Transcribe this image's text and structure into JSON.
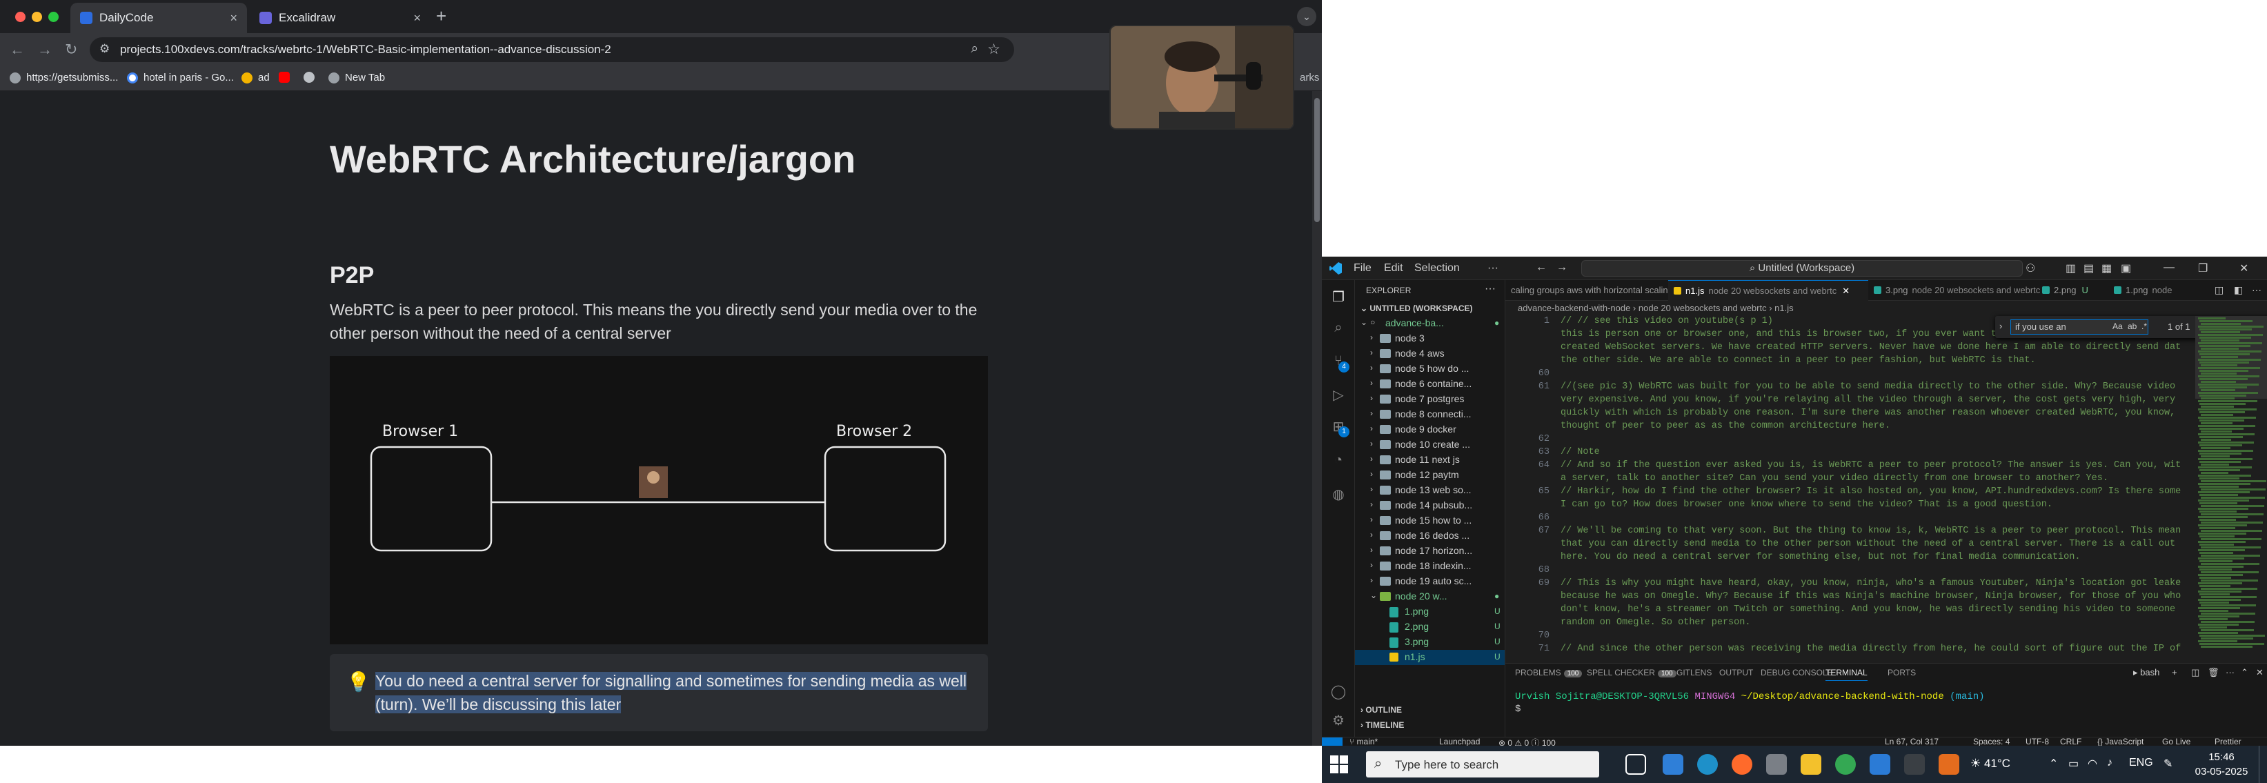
{
  "browser": {
    "tabs": [
      {
        "label": "DailyCode",
        "active": true
      },
      {
        "label": "Excalidraw",
        "active": false
      }
    ],
    "url": "projects.100xdevs.com/tracks/webrtc-1/WebRTC-Basic-implementation--advance-discussion-2",
    "bookmarks": [
      "https://getsubmiss...",
      "hotel in paris - Go...",
      "ad",
      "New Tab"
    ],
    "bookmarks_more": "arks"
  },
  "page": {
    "title": "WebRTC Architecture/jargon",
    "section_heading": "P2P",
    "paragraph": "WebRTC is a peer to peer protocol. This means the you directly send your media over to the other person without the need of a central server",
    "diagram": {
      "left_label": "Browser 1",
      "right_label": "Browser 2"
    },
    "callout": {
      "text_highlighted": "You do need a central server for signalling and sometimes for sending media as well (turn). We’ll be discussing this later"
    }
  },
  "vscode": {
    "menu": [
      "File",
      "Edit",
      "Selection",
      "···"
    ],
    "search": "Untitled (Workspace)",
    "explorer_title": "EXPLORER",
    "workspace_label": "UNTITLED (WORKSPACE)",
    "tree": [
      {
        "label": "advance-ba...",
        "type": "root",
        "badge": "●"
      },
      {
        "label": "node 3",
        "type": "folder"
      },
      {
        "label": "node 4 aws",
        "type": "folder"
      },
      {
        "label": "node 5 how do ...",
        "type": "folder"
      },
      {
        "label": "node 6 containe...",
        "type": "folder"
      },
      {
        "label": "node 7 postgres",
        "type": "folder"
      },
      {
        "label": "node 8 connecti...",
        "type": "folder"
      },
      {
        "label": "node 9 docker",
        "type": "folder"
      },
      {
        "label": "node 10 create ...",
        "type": "folder"
      },
      {
        "label": "node 11 next js",
        "type": "folder"
      },
      {
        "label": "node 12 paytm",
        "type": "folder"
      },
      {
        "label": "node 13 web so...",
        "type": "folder"
      },
      {
        "label": "node 14 pubsub...",
        "type": "folder"
      },
      {
        "label": "node 15 how to ...",
        "type": "folder"
      },
      {
        "label": "node 16 dedos ...",
        "type": "folder"
      },
      {
        "label": "node 17 horizon...",
        "type": "folder"
      },
      {
        "label": "node 18 indexin...",
        "type": "folder"
      },
      {
        "label": "node 19 auto sc...",
        "type": "folder"
      },
      {
        "label": "node 20 w...",
        "type": "openfolder",
        "badge": "●"
      },
      {
        "label": "1.png",
        "type": "png",
        "badge": "U"
      },
      {
        "label": "2.png",
        "type": "png",
        "badge": "U"
      },
      {
        "label": "3.png",
        "type": "png",
        "badge": "U"
      },
      {
        "label": "n1.js",
        "type": "js",
        "badge": "U",
        "selected": true
      }
    ],
    "outline": "OUTLINE",
    "timeline": "TIMELINE",
    "tabs": [
      {
        "label": "caling groups aws with horizontal scaling",
        "kind": "plain"
      },
      {
        "label": "n1.js",
        "path": "node 20 websockets and webrtc",
        "kind": "js",
        "active": true
      },
      {
        "label": "3.png",
        "path": "node 20 websockets and webrtc",
        "kind": "png"
      },
      {
        "label": "2.png",
        "path": "U",
        "kind": "png"
      },
      {
        "label": "1.png",
        "path": "node",
        "kind": "png"
      }
    ],
    "breadcrumb": "advance-backend-with-node  ›  node 20 websockets and webrtc  ›  n1.js",
    "find": {
      "query": "if you use an",
      "result": "1 of 1"
    },
    "code": [
      {
        "n": "1",
        "t": "// // see this video on youtube(s p 1)"
      },
      {
        "n": "",
        "t": "this is person one or browser one, and this is browser two, if you ever want to send them any data, we have sort of"
      },
      {
        "n": "",
        "t": "created WebSocket servers. We have created HTTP servers. Never have we done here I am able to directly send data to"
      },
      {
        "n": "",
        "t": "the other side. We are able to connect in a peer to peer fashion, but WebRTC is that."
      },
      {
        "n": "60",
        "t": ""
      },
      {
        "n": "61",
        "t": "//(see pic 3) WebRTC was built for you to be able to send media directly to the other side. Why? Because video is"
      },
      {
        "n": "",
        "t": "very expensive. And you know, if you're relaying all the video through a server, the cost gets very high, very"
      },
      {
        "n": "",
        "t": "quickly with which is probably one reason. I'm sure there was another reason whoever created WebRTC, you know,"
      },
      {
        "n": "",
        "t": "thought of peer to peer as as the common architecture here."
      },
      {
        "n": "62",
        "t": ""
      },
      {
        "n": "63",
        "t": "// Note"
      },
      {
        "n": "64",
        "t": "// And so if the question ever asked you is, is WebRTC a peer to peer protocol? The answer is yes. Can you, without"
      },
      {
        "n": "",
        "t": "a server, talk to another site? Can you send your video directly from one browser to another? Yes."
      },
      {
        "n": "65",
        "t": "// Harkir, how do I find the other browser? Is it also hosted on, you know, API.hundredxdevs.com? Is there some URL"
      },
      {
        "n": "",
        "t": "I can go to? How does browser one know where to send the video? That is a good question."
      },
      {
        "n": "66",
        "t": ""
      },
      {
        "n": "67",
        "t": "// We'll be coming to that very soon. But the thing to know is, k, WebRTC is a peer to peer protocol. This means"
      },
      {
        "n": "",
        "t": "that you can directly send media to the other person without the need of a central server. There is a call out"
      },
      {
        "n": "",
        "t": "here. You do need a central server for something else, but not for final media communication."
      },
      {
        "n": "68",
        "t": ""
      },
      {
        "n": "69",
        "t": "// This is why you might have heard, okay, you know, ninja, who's a famous Youtuber, Ninja's location got leaked"
      },
      {
        "n": "",
        "t": "because he was on Omegle. Why? Because if this was Ninja's machine browser, Ninja browser, for those of you who"
      },
      {
        "n": "",
        "t": "don't know, he's a streamer on Twitch or something. And you know, he was directly sending his video to someone"
      },
      {
        "n": "",
        "t": "random on Omegle. So other person."
      },
      {
        "n": "70",
        "t": ""
      },
      {
        "n": "71",
        "t": "// And since the other person was receiving the media directly from here, he could sort of figure out the IP of"
      }
    ],
    "panel_tabs": [
      {
        "label": "PROBLEMS",
        "count": "100"
      },
      {
        "label": "SPELL CHECKER",
        "count": "100"
      },
      {
        "label": "GITLENS",
        "count": ""
      },
      {
        "label": "OUTPUT",
        "count": ""
      },
      {
        "label": "DEBUG CONSOLE",
        "count": ""
      },
      {
        "label": "TERMINAL",
        "count": "",
        "active": true
      },
      {
        "label": "PORTS",
        "count": ""
      }
    ],
    "terminal_shell": "bash",
    "terminal": {
      "user": "Urvish Sojitra@DESKTOP-3QRVL56",
      "env": "MINGW64",
      "path": "~/Desktop/advance-backend-with-node",
      "branch": "(main)",
      "prompt": "$"
    },
    "status": {
      "branch": "main*",
      "launchpad": "Launchpad",
      "problems": "⊗ 0 ⚠ 0 ⓘ 100",
      "position": "Ln 67, Col 317",
      "spaces": "Spaces: 4",
      "encoding": "UTF-8",
      "eol": "CRLF",
      "language": "{} JavaScript",
      "golive": "Go Live",
      "prettier": "Prettier"
    }
  },
  "taskbar": {
    "search_placeholder": "Type here to search",
    "weather": "41°C",
    "lang": "ENG",
    "time": "15:46",
    "date": "03-05-2025"
  },
  "colors": {
    "accent": "#0078d4",
    "comment": "#6a9955",
    "page_bg": "#1f2124",
    "highlight": "#3b5478"
  }
}
